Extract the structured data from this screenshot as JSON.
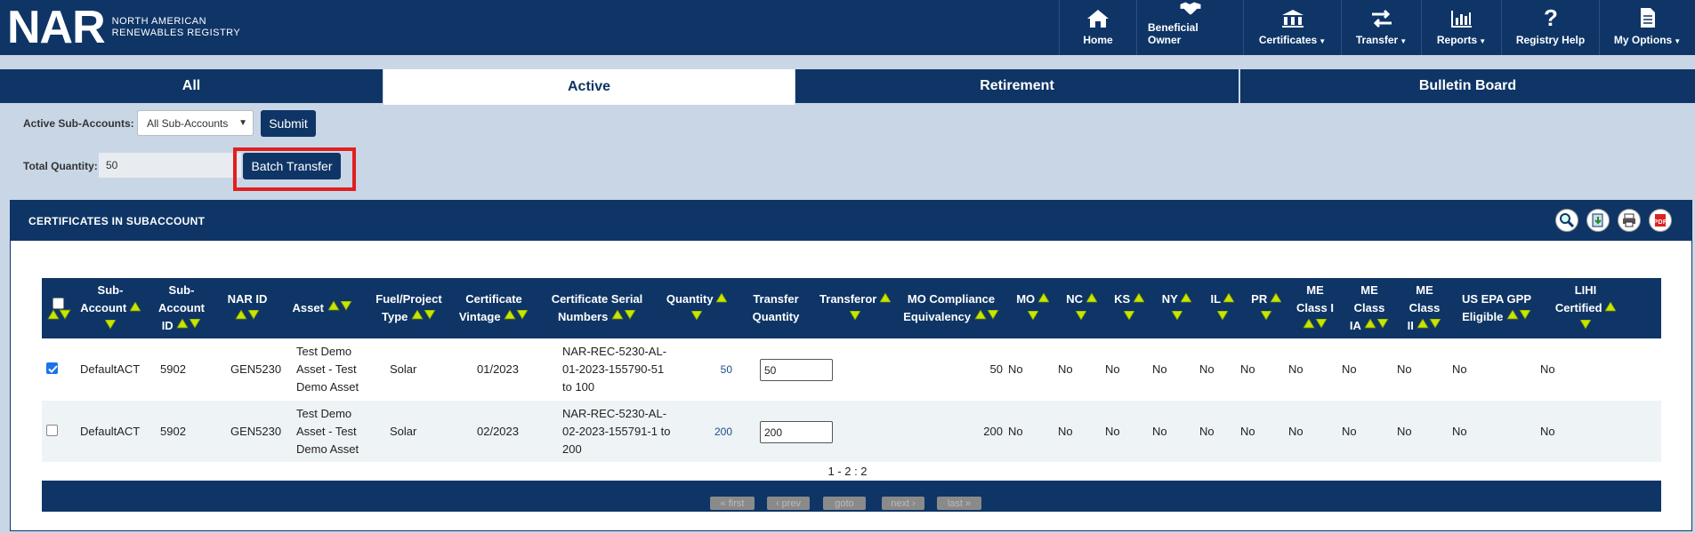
{
  "header": {
    "logo_big": "NAR",
    "logo_line1": "NORTH AMERICAN",
    "logo_line2": "RENEWABLES REGISTRY",
    "nav": {
      "home": "Home",
      "beneficial_owner": "Beneficial Owner",
      "certificates": "Certificates",
      "transfer": "Transfer",
      "reports": "Reports",
      "registry_help": "Registry Help",
      "my_options": "My Options"
    }
  },
  "tabs": [
    "All",
    "Active",
    "Retirement",
    "Bulletin Board"
  ],
  "active_tab": "Active",
  "controls": {
    "subaccount_label": "Active Sub-Accounts:",
    "subaccount_value": "All Sub-Accounts",
    "submit_label": "Submit",
    "total_qty_label": "Total Quantity:",
    "total_qty_value": "50",
    "batch_transfer_label": "Batch Transfer"
  },
  "panel": {
    "title": "CERTIFICATES IN SUBACCOUNT",
    "icons": [
      "search-icon",
      "export-icon",
      "print-icon",
      "pdf-icon"
    ]
  },
  "table": {
    "columns": {
      "sub_account": "Sub-Account",
      "sub_account_id": "Sub-Account ID",
      "nar_id": "NAR ID",
      "asset": "Asset",
      "fuel_type": "Fuel/Project Type",
      "vintage": "Certificate Vintage",
      "serial": "Certificate Serial Numbers",
      "quantity": "Quantity",
      "transfer_qty": "Transfer Quantity",
      "transferor": "Transferor",
      "mo_comp": "MO Compliance Equivalency",
      "mo": "MO",
      "nc": "NC",
      "ks": "KS",
      "ny": "NY",
      "il": "IL",
      "pr": "PR",
      "me1": "ME Class I",
      "me1a": "ME Class IA",
      "me2": "ME Class II",
      "epa": "US EPA GPP Eligible",
      "lihi": "LIHI Certified"
    },
    "rows": [
      {
        "checked": true,
        "sub_account": "DefaultACT",
        "sub_account_id": "5902",
        "nar_id": "GEN5230",
        "asset": "Test Demo Asset - Test Demo Asset",
        "fuel": "Solar",
        "vintage": "01/2023",
        "serial": "NAR-REC-5230-AL-01-2023-155790-51 to 100",
        "quantity": "50",
        "transfer_qty": "50",
        "transferor": "",
        "mo_comp": "50",
        "mo": "No",
        "nc": "No",
        "ks": "No",
        "ny": "No",
        "il": "No",
        "pr": "No",
        "me1": "No",
        "me1a": "No",
        "me2": "No",
        "epa": "No",
        "lihi": "No"
      },
      {
        "checked": false,
        "sub_account": "DefaultACT",
        "sub_account_id": "5902",
        "nar_id": "GEN5230",
        "asset": "Test Demo Asset - Test Demo Asset",
        "fuel": "Solar",
        "vintage": "02/2023",
        "serial": "NAR-REC-5230-AL-02-2023-155791-1 to 200",
        "quantity": "200",
        "transfer_qty": "200",
        "transferor": "",
        "mo_comp": "200",
        "mo": "No",
        "nc": "No",
        "ks": "No",
        "ny": "No",
        "il": "No",
        "pr": "No",
        "me1": "No",
        "me1a": "No",
        "me2": "No",
        "epa": "No",
        "lihi": "No"
      }
    ]
  },
  "pager": {
    "count": "1 - 2 : 2",
    "first": "« first",
    "prev": "‹ prev",
    "goto": "goto",
    "next": "next ›",
    "last": "last »"
  },
  "colors": {
    "navy": "#0e3566",
    "background": "#c9d6e6",
    "highlight": "#e0201f",
    "sort_arrow": "#c8e600"
  }
}
